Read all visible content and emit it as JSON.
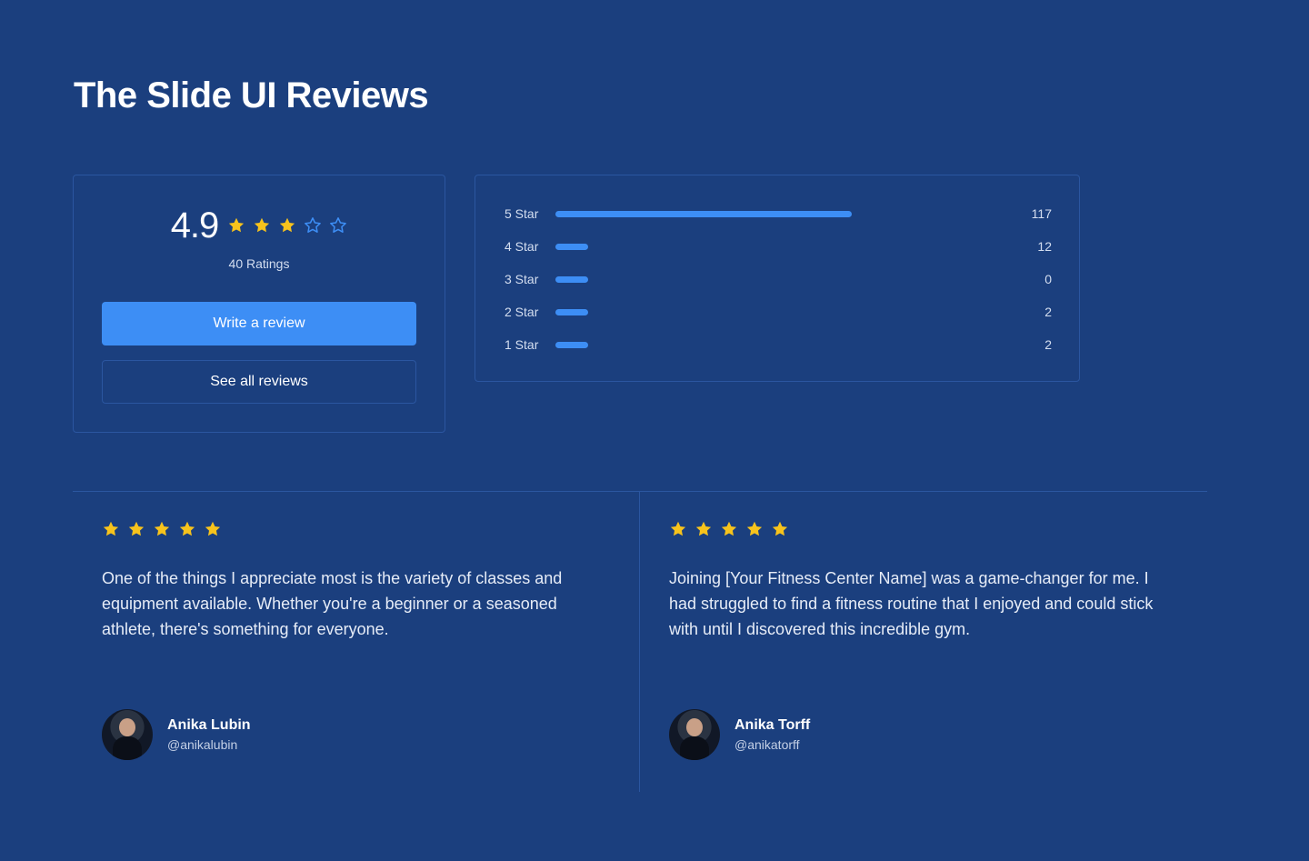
{
  "page": {
    "title": "The Slide UI Reviews"
  },
  "summary": {
    "rating": "4.9",
    "filled_stars": 3,
    "total_stars": 5,
    "ratings_count_label": "40 Ratings",
    "write_review_label": "Write a review",
    "see_all_label": "See all reviews"
  },
  "breakdown": {
    "max_count": 117,
    "rows": [
      {
        "label": "5 Star",
        "count": "117",
        "value": 117
      },
      {
        "label": "4 Star",
        "count": "12",
        "value": 12
      },
      {
        "label": "3 Star",
        "count": "0",
        "value": 0
      },
      {
        "label": "2 Star",
        "count": "2",
        "value": 2
      },
      {
        "label": "1 Star",
        "count": "2",
        "value": 2
      }
    ]
  },
  "reviews": [
    {
      "stars": 5,
      "text": "One of the things I appreciate most is the variety of classes and equipment available. Whether you're a beginner or a seasoned athlete, there's something for everyone.",
      "author_name": "Anika Lubin",
      "author_handle": "@anikalubin"
    },
    {
      "stars": 5,
      "text": "Joining [Your Fitness Center Name] was a game-changer for me. I had struggled to find a fitness routine that I enjoyed and could stick with until I discovered this incredible gym.",
      "author_name": "Anika Torff",
      "author_handle": "@anikatorff"
    }
  ],
  "colors": {
    "background": "#1b3f7e",
    "accent": "#3d8ef5",
    "star_filled": "#f7c31c",
    "star_outline": "#3d8ef5",
    "border": "#2b56a0"
  }
}
